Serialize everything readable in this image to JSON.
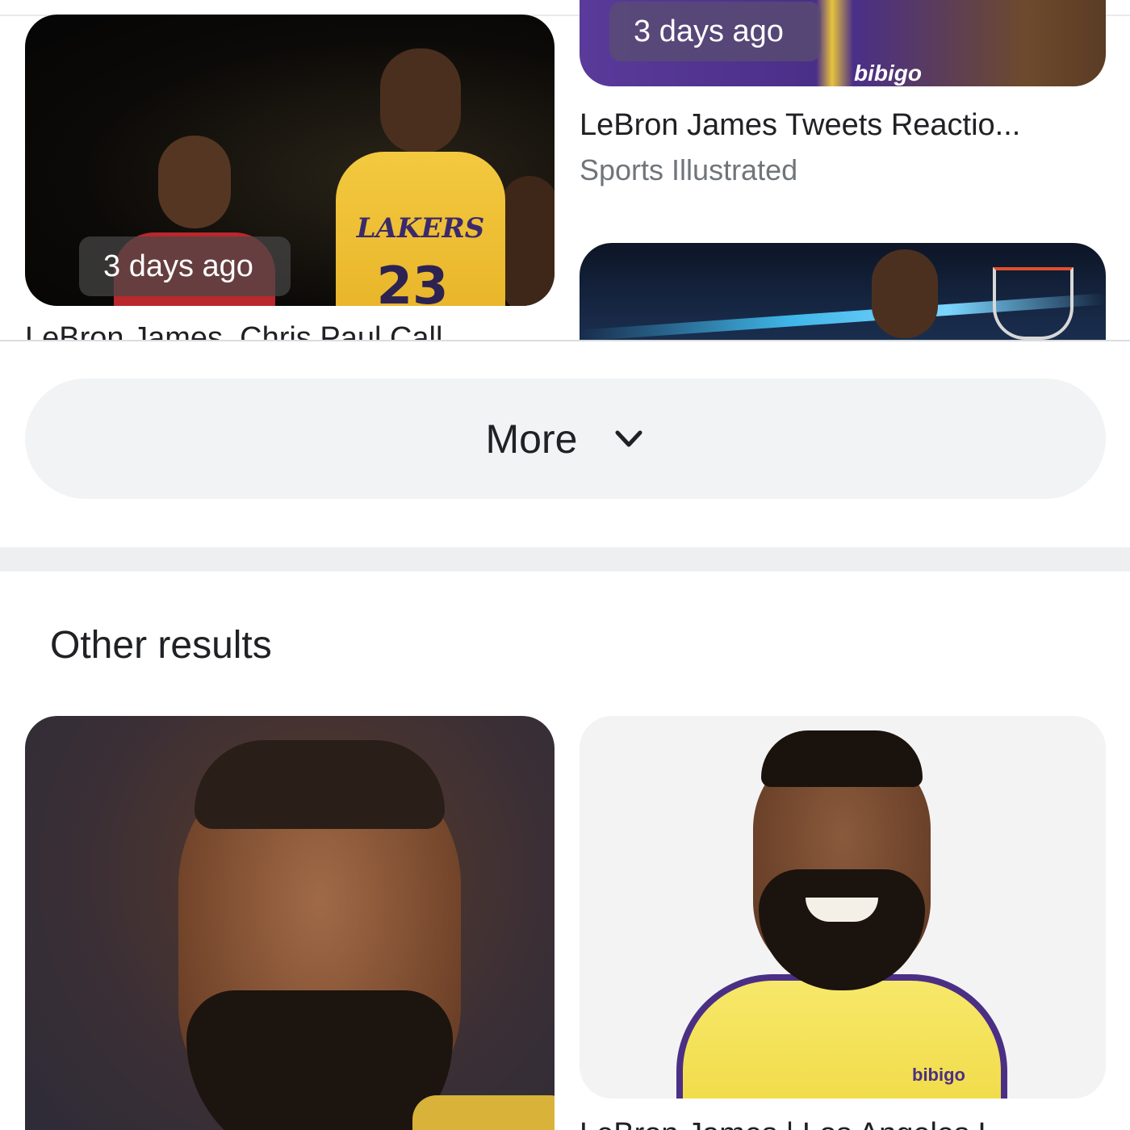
{
  "news": {
    "left": {
      "time": "3 days ago",
      "title_partial": "LeBron James, Chris Paul Call"
    },
    "right_top": {
      "time": "3 days ago",
      "brand": "bibigo",
      "title": "LeBron James Tweets Reactio...",
      "source": "Sports Illustrated"
    },
    "left_jersey": {
      "team": "LAKERS",
      "number": "23"
    }
  },
  "more_button": {
    "label": "More",
    "icon": "chevron-down-icon"
  },
  "other_results": {
    "title": "Other results",
    "right_brand": "bibigo",
    "right_caption_partial": "LeBron James | Los Angeles L"
  },
  "colors": {
    "chip_bg": "#f1f3f4",
    "text": "#202124",
    "secondary_text": "#70757a"
  }
}
